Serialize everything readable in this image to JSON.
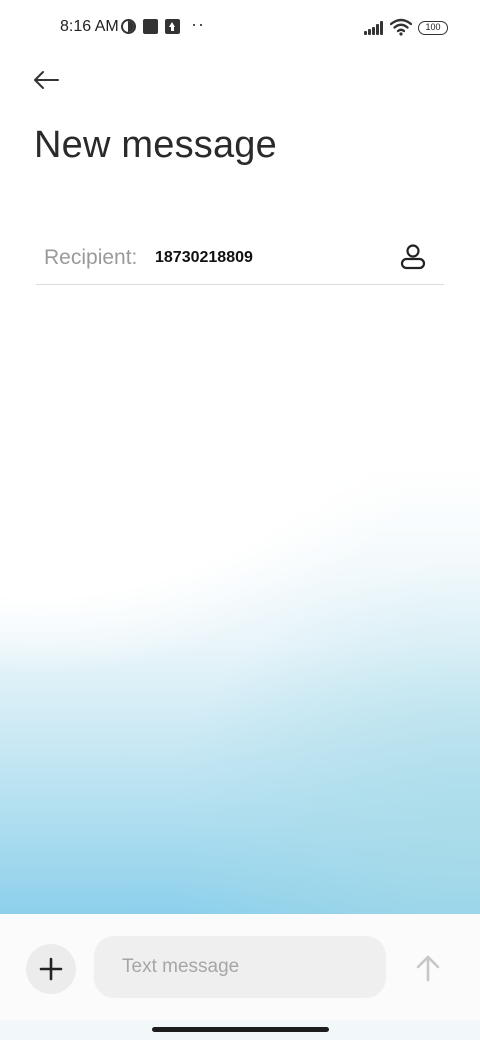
{
  "status_bar": {
    "time": "8:16 AM",
    "dots": "··",
    "battery": "100",
    "icons": [
      "half-circle-icon",
      "square-notification-icon",
      "upload-icon",
      "more-dots-icon",
      "signal-icon",
      "wifi-icon",
      "battery-icon"
    ]
  },
  "header": {
    "back_icon": "back-arrow-icon",
    "title": "New message"
  },
  "recipient": {
    "label": "Recipient:",
    "value": "18730218809",
    "contact_icon": "contact-person-icon"
  },
  "composer": {
    "add_icon": "plus-icon",
    "placeholder": "Text message",
    "send_icon": "send-arrow-up-icon"
  },
  "colors": {
    "accent_blue": "#82cde9",
    "text_dark": "#2a2a2a",
    "text_gray": "#9a9a9a",
    "input_bg": "#efefef",
    "send_disabled": "#c7c7c7"
  }
}
